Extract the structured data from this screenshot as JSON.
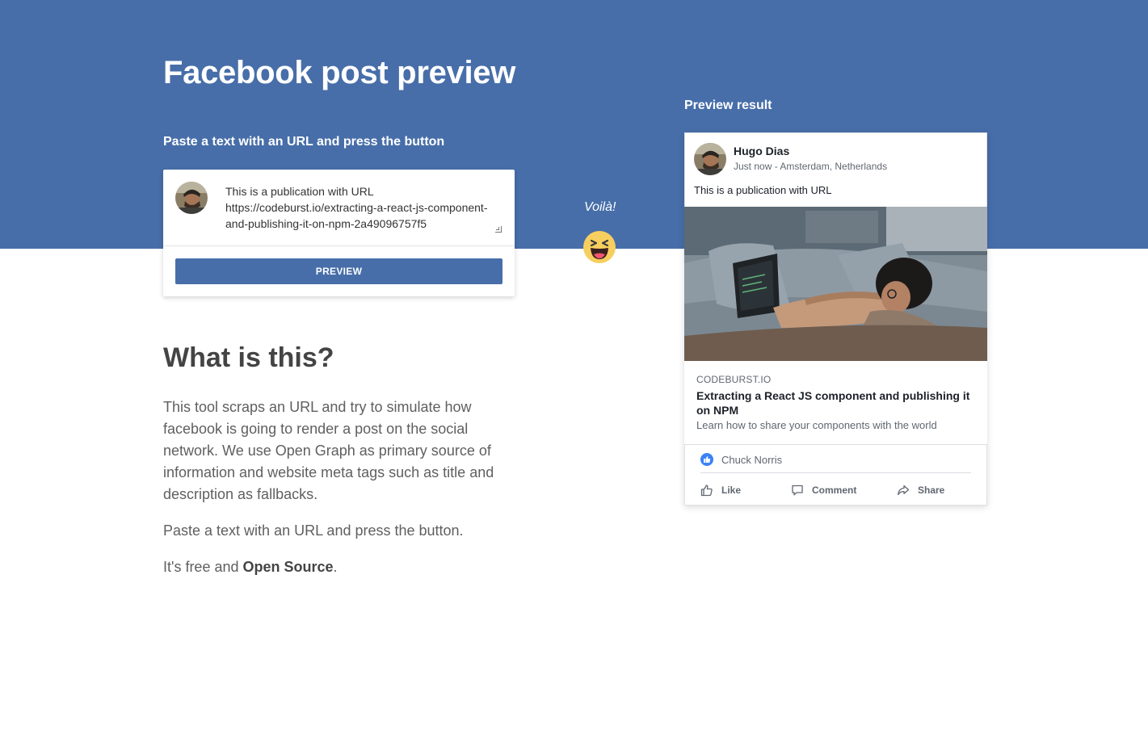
{
  "header": {
    "title": "Facebook post preview",
    "subtitle": "Paste a text with an URL and press the button"
  },
  "input_card": {
    "avatar_icon": "user-avatar-photo",
    "text": "This is a publication with URL https://codeburst.io/extracting-a-react-js-component-and-publishing-it-on-npm-2a49096757f5",
    "button_label": "PREVIEW"
  },
  "voila": {
    "text": "Voilà!",
    "emoji_icon": "laughing-emoji-icon"
  },
  "info": {
    "title": "What is this?",
    "paragraph_1": "This tool scraps an URL and try to simulate how facebook is going to render a post on the social network. We use Open Graph as primary source of information and website meta tags such as title and description as fallbacks.",
    "paragraph_2": "Paste a text with an URL and press the button.",
    "paragraph_3_prefix": "It's free and ",
    "paragraph_3_link": "Open Source",
    "paragraph_3_suffix": "."
  },
  "preview": {
    "label": "Preview result",
    "author": "Hugo Dias",
    "meta": "Just now - Amsterdam, Netherlands",
    "post_text": "This is a publication with URL",
    "link": {
      "domain": "CODEBURST.IO",
      "title": "Extracting a React JS component and publishing it on NPM",
      "description": "Learn how to share your components with the world"
    },
    "likes_name": "Chuck Norris",
    "actions": {
      "like": "Like",
      "comment": "Comment",
      "share": "Share"
    }
  },
  "colors": {
    "brand": "#476ea9",
    "like_badge": "#3b82f6"
  }
}
